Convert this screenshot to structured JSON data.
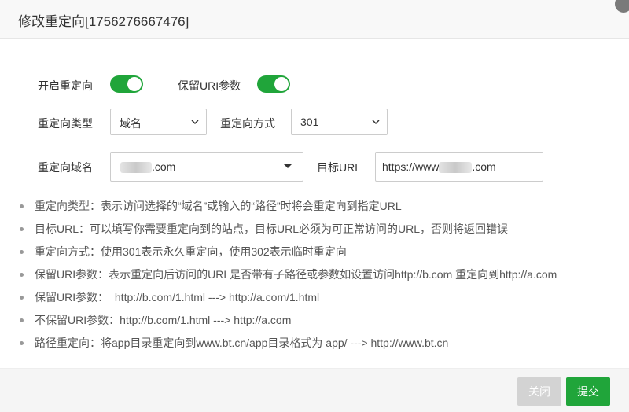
{
  "dialog": {
    "title": "修改重定向[1756276667476]"
  },
  "form": {
    "enable_redirect_label": "开启重定向",
    "enable_redirect_on": true,
    "keep_uri_label": "保留URI参数",
    "keep_uri_on": true,
    "redirect_type_label": "重定向类型",
    "redirect_type_value": "域名",
    "redirect_method_label": "重定向方式",
    "redirect_method_value": "301",
    "redirect_domain_label": "重定向域名",
    "redirect_domain_value": ".com",
    "target_url_label": "目标URL",
    "target_url_prefix": "https://www",
    "target_url_suffix": ".com"
  },
  "notes": [
    "重定向类型：表示访问选择的“域名”或输入的“路径”时将会重定向到指定URL",
    "目标URL：可以填写你需要重定向到的站点，目标URL必须为可正常访问的URL，否则将返回错误",
    "重定向方式：使用301表示永久重定向，使用302表示临时重定向",
    "保留URI参数：表示重定向后访问的URL是否带有子路径或参数如设置访问http://b.com 重定向到http://a.com",
    "保留URI参数：  http://b.com/1.html ---> http://a.com/1.html",
    "不保留URI参数：http://b.com/1.html ---> http://a.com",
    "路径重定向：将app目录重定向到www.bt.cn/app目录格式为 app/ ---> http://www.bt.cn"
  ],
  "footer": {
    "close_label": "关闭",
    "submit_label": "提交"
  },
  "colors": {
    "accent": "#20a53a",
    "disabled_button": "#d3d3d3"
  }
}
